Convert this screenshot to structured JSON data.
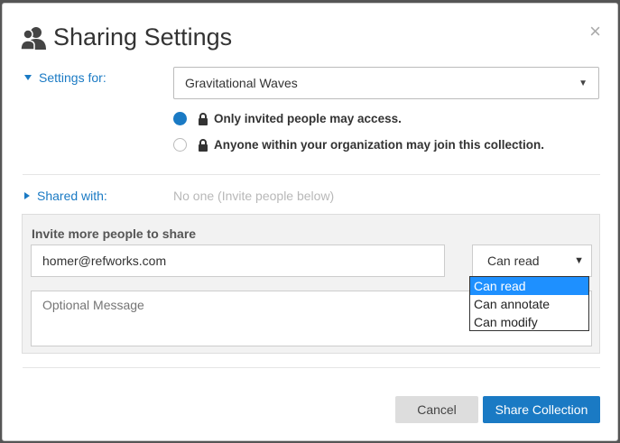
{
  "dialog": {
    "title": "Sharing Settings",
    "close_symbol": "×"
  },
  "settings_for": {
    "label": "Settings for:",
    "selected_collection": "Gravitational Waves"
  },
  "access_options": [
    {
      "label": "Only invited people may access.",
      "checked": true
    },
    {
      "label": "Anyone within your organization may join this collection.",
      "checked": false
    }
  ],
  "shared_with": {
    "label": "Shared with:",
    "value": "No one (Invite people below)"
  },
  "invite": {
    "title": "Invite more people to share",
    "email_value": "homer@refworks.com",
    "permission_selected": "Can read",
    "permission_options": [
      "Can read",
      "Can annotate",
      "Can modify"
    ],
    "message_placeholder": "Optional Message"
  },
  "buttons": {
    "cancel": "Cancel",
    "share": "Share Collection"
  },
  "colors": {
    "accent": "#1a7ac4",
    "dropdown_highlight": "#1e90ff"
  },
  "icons": {
    "title": "people-icon",
    "lock": "lock-icon"
  }
}
